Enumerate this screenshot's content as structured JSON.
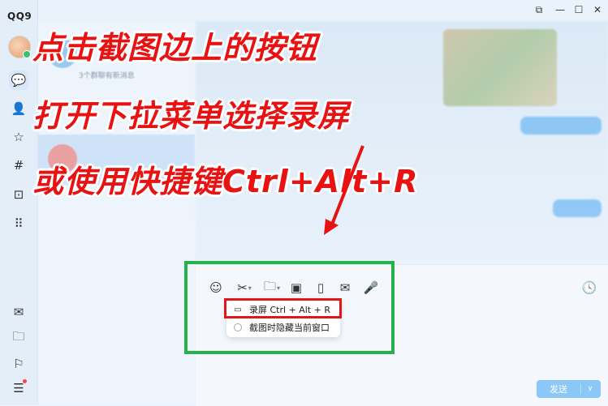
{
  "app": {
    "brand": "QQ9"
  },
  "window_buttons": [
    "⧉",
    "—",
    "☐",
    "✕"
  ],
  "nav": [
    {
      "name": "chat-icon",
      "glyph": "💬",
      "active": true
    },
    {
      "name": "contacts-icon",
      "glyph": "👤"
    },
    {
      "name": "star-icon",
      "glyph": "☆"
    },
    {
      "name": "hash-icon",
      "glyph": "#"
    },
    {
      "name": "book-icon",
      "glyph": "⊡"
    },
    {
      "name": "apps-grid-icon",
      "glyph": "⠿"
    },
    {
      "name": "mail-icon",
      "glyph": "✉"
    },
    {
      "name": "folder-icon",
      "glyph": "🗀"
    },
    {
      "name": "bookmark-icon",
      "glyph": "⚐"
    },
    {
      "name": "menu-icon",
      "glyph": "☰"
    }
  ],
  "list": {
    "subtitle": "3个群聊有新消息"
  },
  "captions": {
    "line1": "点击截图边上的按钮",
    "line2": "打开下拉菜单选择录屏",
    "line3": "或使用快捷键Ctrl+Alt+R"
  },
  "toolbar": [
    {
      "name": "emoji-icon",
      "glyph": "☺"
    },
    {
      "name": "scissors-icon",
      "glyph": "✂",
      "caret": true
    },
    {
      "name": "folder-icon",
      "glyph": "🗀",
      "caret": true
    },
    {
      "name": "image-icon",
      "glyph": "▣"
    },
    {
      "name": "shake-icon",
      "glyph": "▯"
    },
    {
      "name": "red-packet-icon",
      "glyph": "✉"
    },
    {
      "name": "microphone-icon",
      "glyph": "🎤"
    }
  ],
  "history_icon": "🕓",
  "menu": {
    "record_label": "录屏 Ctrl + Alt + R",
    "hide_window_label": "截图时隐藏当前窗口"
  },
  "send": {
    "label": "发送",
    "chevron": "∨"
  },
  "colors": {
    "caption_red": "#e81212",
    "highlight_green": "#27b14a",
    "highlight_red": "#e0161b",
    "accent_blue": "#1e88f7"
  }
}
